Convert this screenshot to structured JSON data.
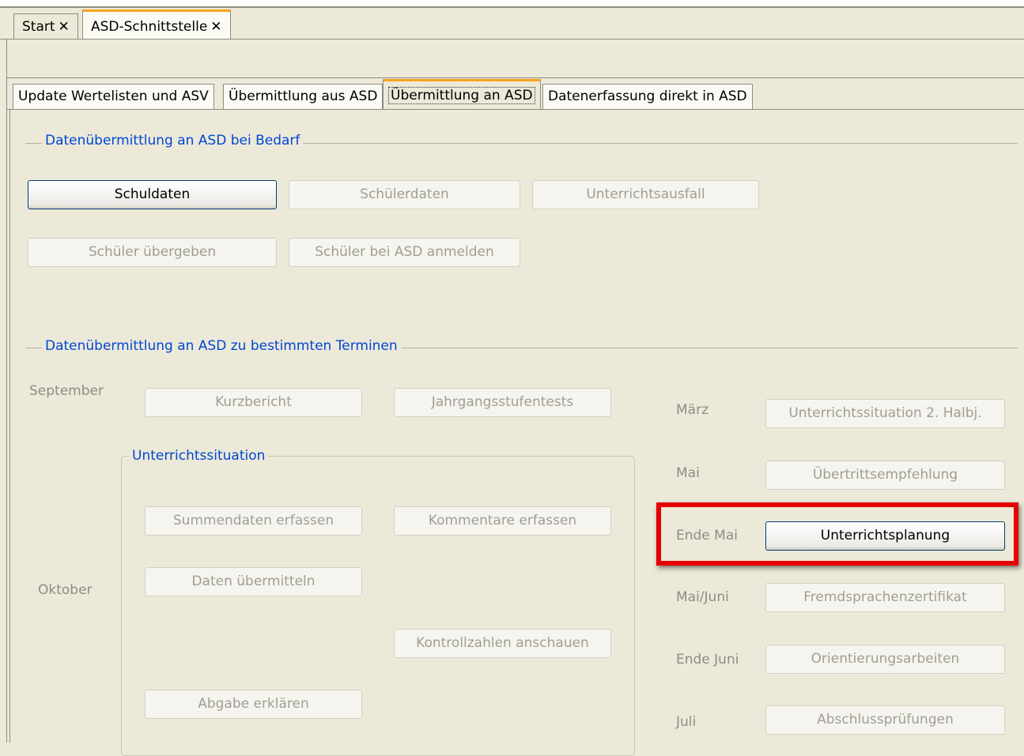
{
  "outer_tabs": [
    {
      "label": "Start"
    },
    {
      "label": "ASD-Schnittstelle"
    }
  ],
  "inner_tabs": [
    {
      "label": "Update Wertelisten und ASV"
    },
    {
      "label": "Übermittlung aus ASD"
    },
    {
      "label": "Übermittlung an ASD"
    },
    {
      "label": "Datenerfassung direkt in ASD"
    }
  ],
  "bedarf": {
    "title": "Datenübermittlung an ASD bei Bedarf",
    "buttons": {
      "schuldaten": "Schuldaten",
      "schuelerdaten": "Schülerdaten",
      "unterrichtsausfall": "Unterrichtsausfall",
      "schueler_uebergeben": "Schüler übergeben",
      "schueler_anmelden": "Schüler bei ASD anmelden"
    }
  },
  "termine": {
    "title": "Datenübermittlung an ASD zu bestimmten Terminen",
    "months": {
      "september": "September",
      "oktober": "Oktober",
      "maerz": "März",
      "mai": "Mai",
      "ende_mai": "Ende Mai",
      "mai_juni": "Mai/Juni",
      "ende_juni": "Ende Juni",
      "juli": "Juli"
    },
    "buttons": {
      "kurzbericht": "Kurzbericht",
      "jahrgangsstufentests": "Jahrgangsstufentests",
      "unterrichtssituation_2": "Unterrichtssituation 2. Halbj.",
      "uebertrittsempfehlung": "Übertrittsempfehlung",
      "unterrichtsplanung": "Unterrichtsplanung",
      "fremdsprachenzertifikat": "Fremdsprachenzertifikat",
      "orientierungsarbeiten": "Orientierungsarbeiten",
      "abschlusspruefungen": "Abschlussprüfungen"
    },
    "unterrichtssituation": {
      "title": "Unterrichtssituation",
      "summendaten": "Summendaten erfassen",
      "kommentare": "Kommentare erfassen",
      "daten_uebermitteln": "Daten übermitteln",
      "kontrollzahlen": "Kontrollzahlen anschauen",
      "abgabe": "Abgabe erklären"
    }
  },
  "colors": {
    "accent_tab": "#f6a21c",
    "group_title": "#0046d5",
    "highlight": "#e40000"
  }
}
